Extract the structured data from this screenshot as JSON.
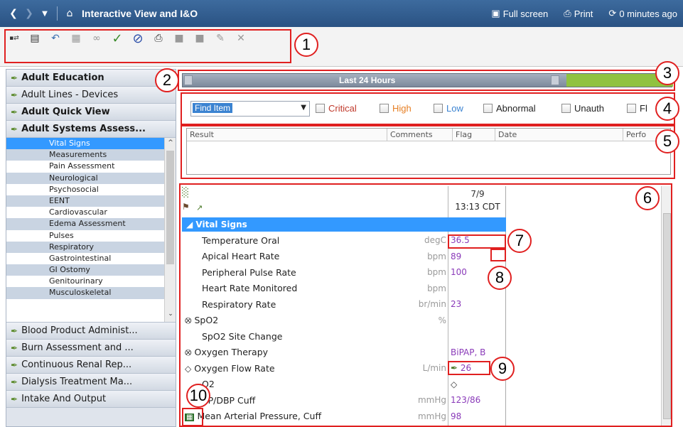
{
  "titlebar": {
    "title": "Interactive View and I&O",
    "full_screen": "Full screen",
    "print": "Print",
    "refresh_status": "0 minutes ago"
  },
  "toolbar": {
    "icons": [
      "insert-row-icon",
      "grid-icon",
      "undo-icon",
      "calculator-icon",
      "glasses-icon",
      "checkmark-icon",
      "cancel-icon",
      "print-icon",
      "document-icon",
      "document-icon",
      "edit-icon",
      "close-icon"
    ]
  },
  "sidebar": {
    "categories_top": [
      {
        "label": "Adult Education",
        "bold": true
      },
      {
        "label": "Adult Lines - Devices",
        "bold": false
      },
      {
        "label": "Adult Quick View",
        "bold": true
      },
      {
        "label": "Adult Systems Assess...",
        "bold": true
      }
    ],
    "subitems": [
      {
        "label": "Vital Signs",
        "selected": true
      },
      {
        "label": "Measurements"
      },
      {
        "label": "Pain Assessment"
      },
      {
        "label": "Neurological"
      },
      {
        "label": "Psychosocial"
      },
      {
        "label": "EENT"
      },
      {
        "label": "Cardiovascular"
      },
      {
        "label": "Edema Assessment"
      },
      {
        "label": "Pulses"
      },
      {
        "label": "Respiratory"
      },
      {
        "label": "Gastrointestinal"
      },
      {
        "label": "GI Ostomy"
      },
      {
        "label": "Genitourinary"
      },
      {
        "label": "Musculoskeletal"
      }
    ],
    "categories_bottom": [
      {
        "label": "Blood Product Administ..."
      },
      {
        "label": "Burn Assessment and ..."
      },
      {
        "label": "Continuous Renal Rep..."
      },
      {
        "label": "Dialysis Treatment Ma..."
      },
      {
        "label": "Intake And Output"
      }
    ]
  },
  "timebar": {
    "label": "Last 24 Hours"
  },
  "filterbar": {
    "find_item": "Find Item",
    "filters": [
      {
        "label": "Critical",
        "color": "#c0392b"
      },
      {
        "label": "High",
        "color": "#e67e22"
      },
      {
        "label": "Low",
        "color": "#3b83d1"
      },
      {
        "label": "Abnormal",
        "color": "#333333"
      },
      {
        "label": "Unauth",
        "color": "#333333"
      },
      {
        "label": "Fl",
        "color": "#333333"
      }
    ]
  },
  "resultlist": {
    "columns": [
      "Result",
      "Comments",
      "Flag",
      "Date",
      "Perfo"
    ]
  },
  "flowsheet": {
    "date": "7/9",
    "time": "13:13 CDT",
    "section": "Vital Signs",
    "rows": [
      {
        "name": "Temperature Oral",
        "unit": "degC",
        "value": "36.5"
      },
      {
        "name": "Apical Heart Rate",
        "unit": "bpm",
        "value": "89"
      },
      {
        "name": "Peripheral Pulse Rate",
        "unit": "bpm",
        "value": "100"
      },
      {
        "name": "Heart Rate Monitored",
        "unit": "bpm",
        "value": ""
      },
      {
        "name": "Respiratory Rate",
        "unit": "br/min",
        "value": "23"
      },
      {
        "name": "SpO2",
        "unit": "%",
        "value": "",
        "icon": "diamond-arrow"
      },
      {
        "name": "SpO2 Site Change",
        "unit": "",
        "value": ""
      },
      {
        "name": "Oxygen Therapy",
        "unit": "",
        "value": "BiPAP, B",
        "icon": "diamond-arrow"
      },
      {
        "name": "Oxygen Flow Rate",
        "unit": "L/min",
        "value": "26",
        "icon": "diamond"
      },
      {
        "name": "O2",
        "unit": "",
        "value": "◇"
      },
      {
        "name": "BP/DBP Cuff",
        "unit": "mmHg",
        "value": "123/86"
      },
      {
        "name": "Mean Arterial Pressure, Cuff",
        "unit": "mmHg",
        "value": "98",
        "icon": "calculator"
      }
    ]
  },
  "callouts": [
    "1",
    "2",
    "3",
    "4",
    "5",
    "6",
    "7",
    "8",
    "9",
    "10"
  ]
}
